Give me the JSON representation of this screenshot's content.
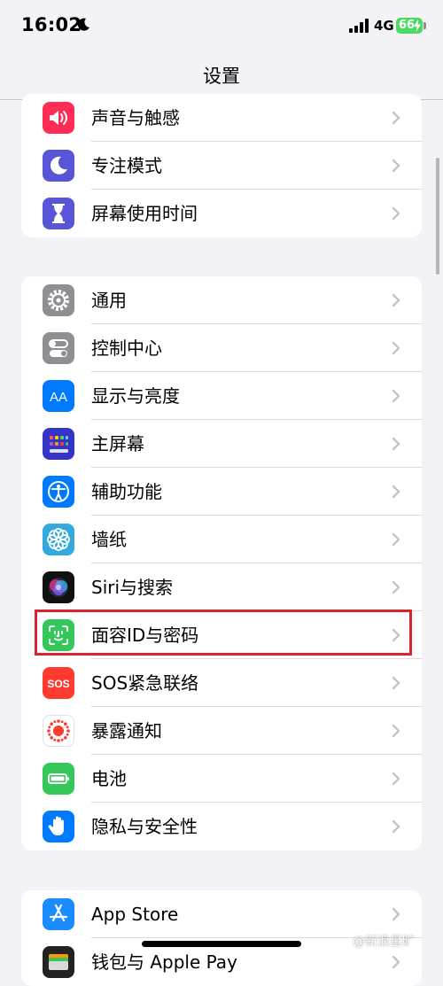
{
  "status": {
    "time": "16:02",
    "network": "4G",
    "battery": "66"
  },
  "nav": {
    "title": "设置"
  },
  "group1": [
    {
      "label": "声音与触感",
      "icon": "speaker-icon",
      "color": "#ff2d55"
    },
    {
      "label": "专注模式",
      "icon": "moon-icon",
      "color": "#5856d6"
    },
    {
      "label": "屏幕使用时间",
      "icon": "hourglass-icon",
      "color": "#5856d6"
    }
  ],
  "group2": [
    {
      "label": "通用",
      "icon": "gear-icon",
      "color": "#8e8e93"
    },
    {
      "label": "控制中心",
      "icon": "toggles-icon",
      "color": "#8e8e93"
    },
    {
      "label": "显示与亮度",
      "icon": "text-size-icon",
      "color": "#007aff",
      "icon_text": "AA"
    },
    {
      "label": "主屏幕",
      "icon": "home-screen-icon",
      "color": "#3434c5"
    },
    {
      "label": "辅助功能",
      "icon": "accessibility-icon",
      "color": "#007aff"
    },
    {
      "label": "墙纸",
      "icon": "flower-icon",
      "color": "#34aadc"
    },
    {
      "label": "Siri与搜索",
      "icon": "siri-icon",
      "color": "#111111"
    },
    {
      "label": "面容ID与密码",
      "icon": "face-id-icon",
      "color": "#34c759"
    },
    {
      "label": "SOS紧急联络",
      "icon": "sos-icon",
      "color": "#ff3b30",
      "icon_text": "SOS"
    },
    {
      "label": "暴露通知",
      "icon": "exposure-icon",
      "color": "#ffffff"
    },
    {
      "label": "电池",
      "icon": "battery-icon",
      "color": "#34c759"
    },
    {
      "label": "隐私与安全性",
      "icon": "hand-icon",
      "color": "#007aff"
    }
  ],
  "group3": [
    {
      "label": "App Store",
      "icon": "app-store-icon",
      "color": "#1a8cff"
    },
    {
      "label": "钱包与 Apple Pay",
      "icon": "wallet-icon",
      "color": "#222222"
    }
  ],
  "watermark": "@新浪星旷"
}
